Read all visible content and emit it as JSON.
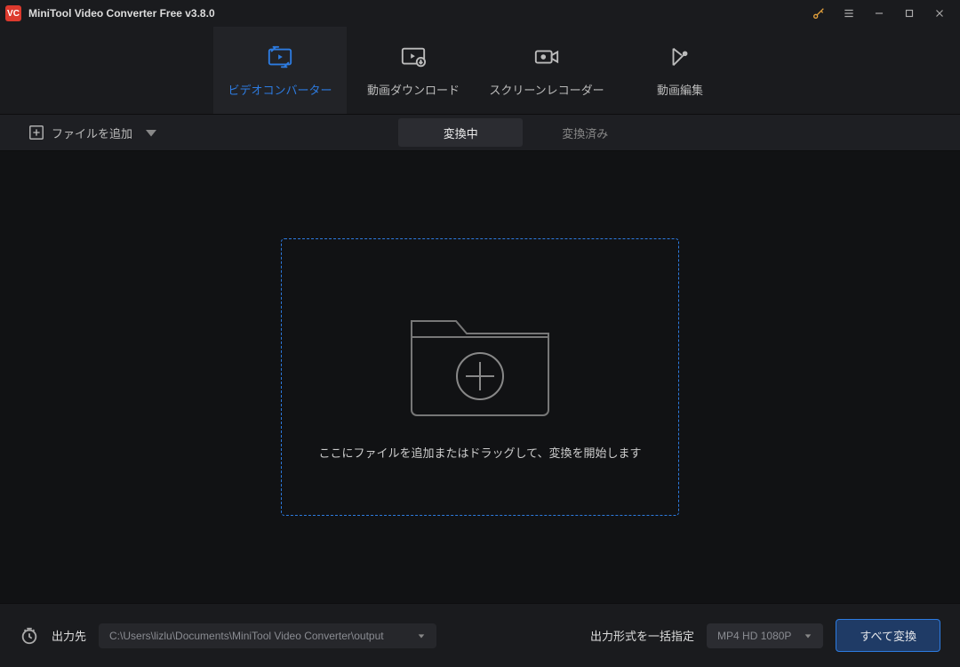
{
  "titlebar": {
    "app_name": "MiniTool Video Converter Free v3.8.0",
    "logo_text": "VC"
  },
  "tabs": {
    "converter": "ビデオコンバーター",
    "download": "動画ダウンロード",
    "recorder": "スクリーンレコーダー",
    "editor": "動画編集"
  },
  "toolbar": {
    "add_files": "ファイルを追加",
    "sub_converting": "変換中",
    "sub_converted": "変換済み"
  },
  "dropzone": {
    "hint": "ここにファイルを追加またはドラッグして、変換を開始します"
  },
  "footer": {
    "output_label": "出力先",
    "output_path": "C:\\Users\\lizlu\\Documents\\MiniTool Video Converter\\output",
    "format_label": "出力形式を一括指定",
    "format_value": "MP4 HD 1080P",
    "convert_all": "すべて変換"
  }
}
